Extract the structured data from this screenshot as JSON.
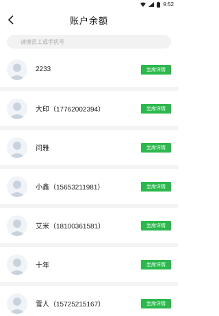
{
  "status_bar": {
    "time": "9:52"
  },
  "header": {
    "title": "账户余额"
  },
  "search": {
    "placeholder": "请搜员工或手机号"
  },
  "users": [
    {
      "name": "2233",
      "button": "坐席详情"
    },
    {
      "name": "大印（17762002394）",
      "button": "坐席详情"
    },
    {
      "name": "问雅",
      "button": "坐席详情"
    },
    {
      "name": "小鑫（15653211981）",
      "button": "坐席详情"
    },
    {
      "name": "艾米（18100361581）",
      "button": "坐席详情"
    },
    {
      "name": "十年",
      "button": "坐席详情"
    },
    {
      "name": "雪人（15725215167）",
      "button": "坐席详情"
    }
  ],
  "colors": {
    "accent": "#2db84d",
    "divider": "#f4f4f4"
  }
}
